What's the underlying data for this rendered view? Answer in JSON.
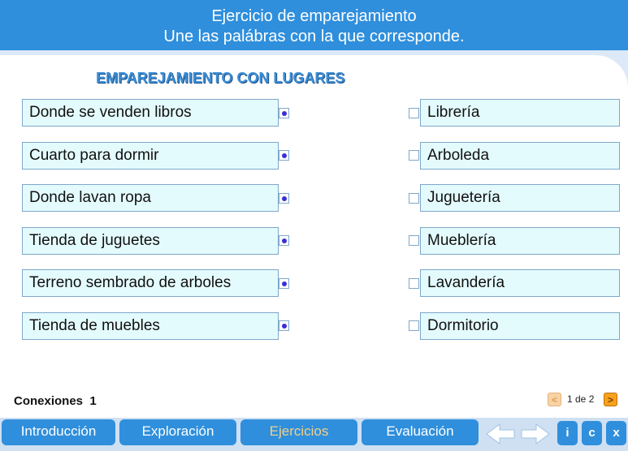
{
  "header": {
    "line1": "Ejercicio de emparejamiento",
    "line2": "Une las palábras con la que corresponde."
  },
  "section_title": "EMPAREJAMIENTO CON LUGARES",
  "left_items": [
    "Donde se venden libros",
    "Cuarto para dormir",
    "Donde lavan ropa",
    "Tienda de juguetes",
    "Terreno sembrado de arboles",
    "Tienda de muebles"
  ],
  "right_items": [
    "Librería",
    "Arboleda",
    "Juguetería",
    "Mueblería",
    "Lavandería",
    "Dormitorio"
  ],
  "connections": {
    "label": "Conexiones",
    "value": "1"
  },
  "pager": {
    "text": "1 de 2",
    "prev": "<",
    "next": ">"
  },
  "nav": {
    "tabs": [
      "Introducción",
      "Exploración",
      "Ejercicios",
      "Evaluación"
    ],
    "active_tab": "Ejercicios",
    "info": "i",
    "credits": "c",
    "close": "x"
  },
  "colors": {
    "primary": "#2f8fdc",
    "box_fill": "#e4fbfd",
    "dot": "#3b2fd4",
    "active_tab_text": "#f2d08b"
  }
}
